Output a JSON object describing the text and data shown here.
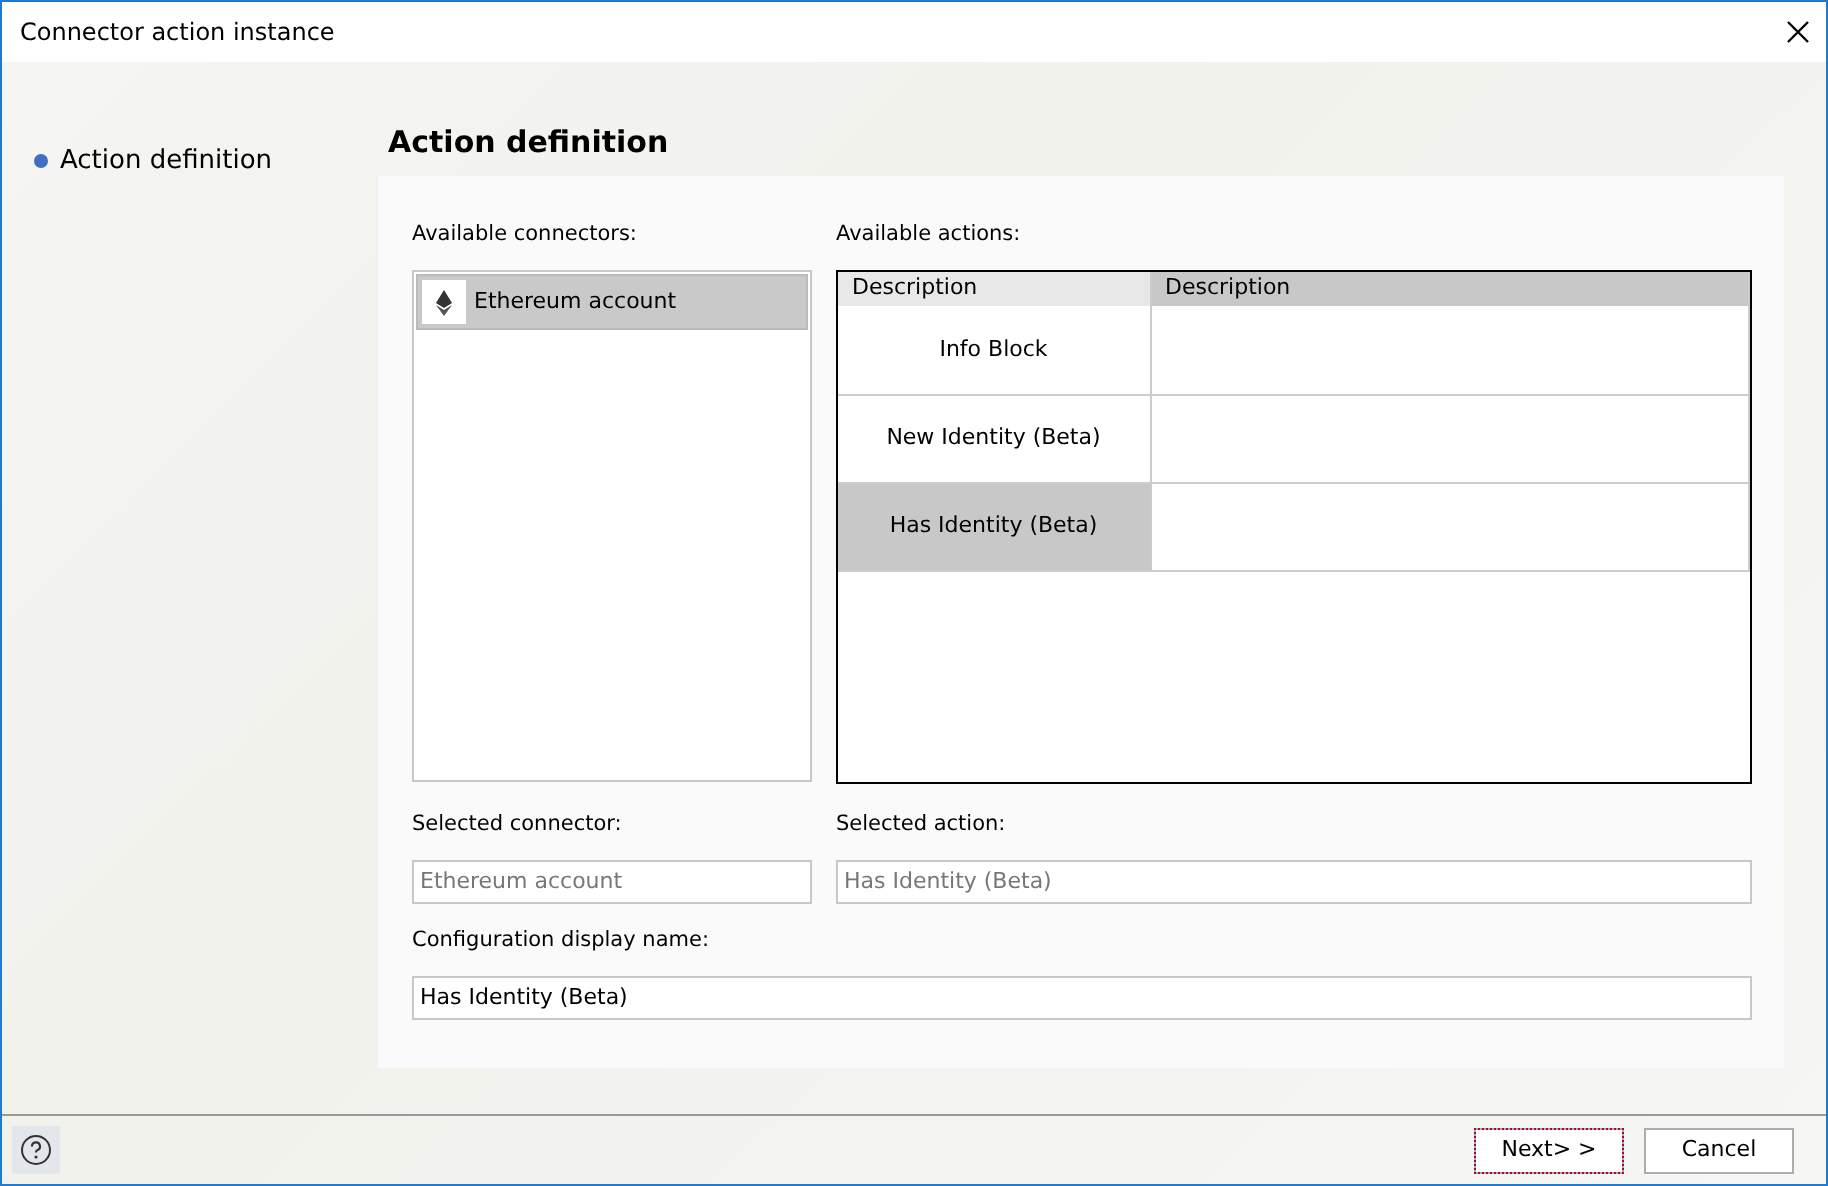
{
  "window": {
    "title": "Connector action instance"
  },
  "sidebar": {
    "items": [
      {
        "label": "Action definition",
        "selected": true
      }
    ]
  },
  "heading": "Action definition",
  "connectors": {
    "label": "Available connectors:",
    "items": [
      {
        "label": "Ethereum account",
        "selected": true
      }
    ]
  },
  "actions": {
    "label": "Available actions:",
    "columns": [
      "Description",
      "Description"
    ],
    "rows": [
      {
        "name": "Info Block",
        "selected": false
      },
      {
        "name": "New Identity (Beta)",
        "selected": false
      },
      {
        "name": "Has Identity (Beta)",
        "selected": true
      }
    ]
  },
  "selected_connector": {
    "label": "Selected connector:",
    "value": "Ethereum account",
    "disabled": true
  },
  "selected_action": {
    "label": "Selected action:",
    "value": "Has Identity (Beta)",
    "disabled": true
  },
  "configuration_name": {
    "label": "Configuration display name:",
    "value": "Has Identity (Beta)",
    "disabled": false
  },
  "buttons": [
    {
      "label": "Next> >",
      "focused": true
    },
    {
      "label": "Cancel",
      "focused": false
    }
  ]
}
